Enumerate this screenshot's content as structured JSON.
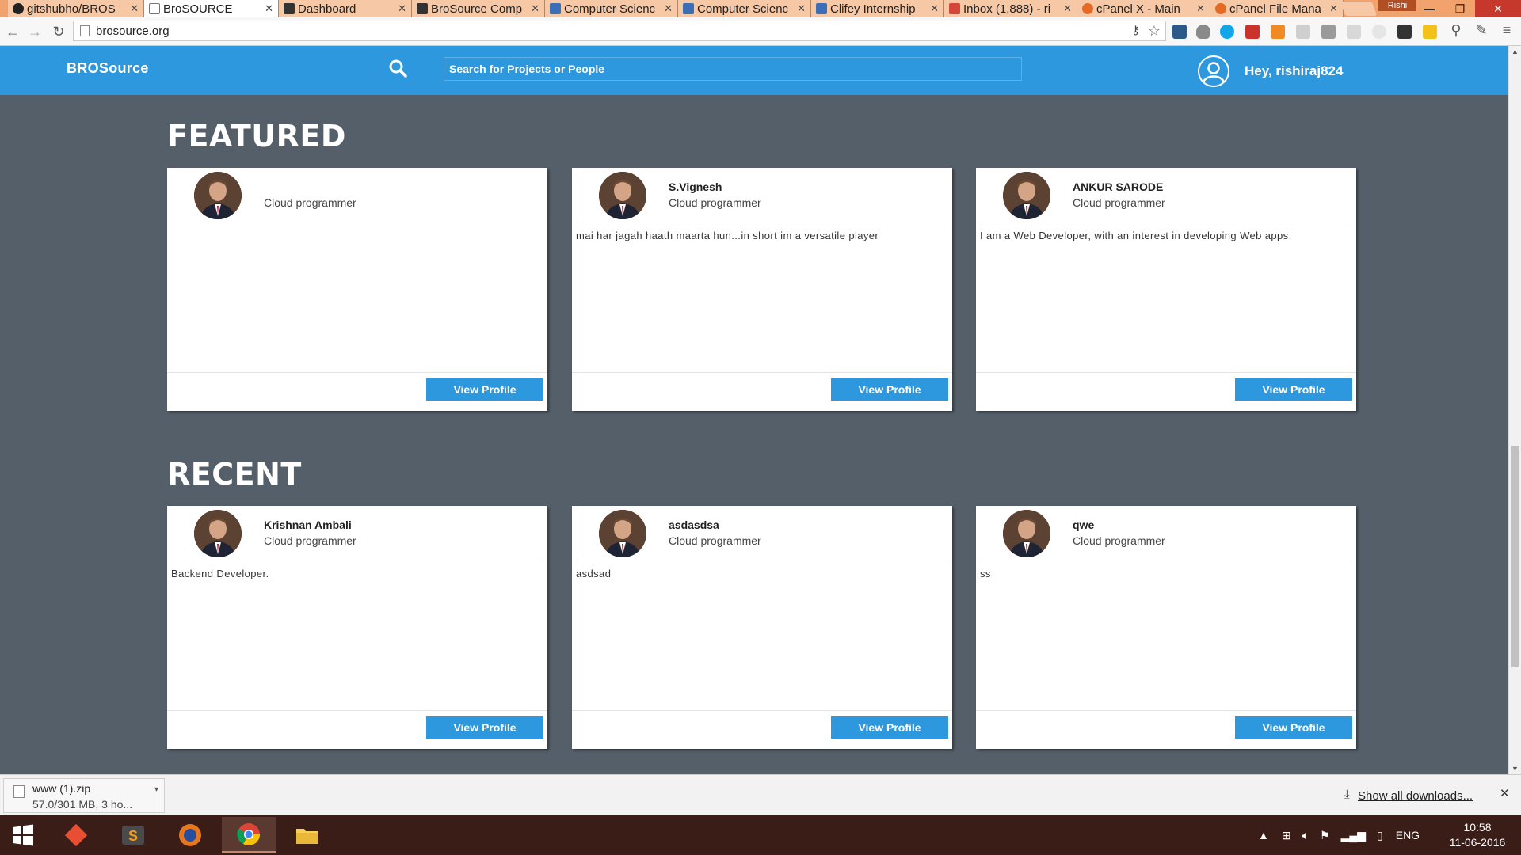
{
  "browser": {
    "tabs": [
      {
        "label": "gitshubho/BROS",
        "icon_color": "#222222",
        "active": false
      },
      {
        "label": "BroSOURCE",
        "icon_color": "#ffffff",
        "active": true
      },
      {
        "label": "Dashboard",
        "icon_color": "#333333",
        "active": false
      },
      {
        "label": "BroSource Comp",
        "icon_color": "#333333",
        "active": false
      },
      {
        "label": "Computer Scienc",
        "icon_color": "#3a6fb5",
        "active": false
      },
      {
        "label": "Computer Scienc",
        "icon_color": "#3a6fb5",
        "active": false
      },
      {
        "label": "Clifey Internship",
        "icon_color": "#3a6fb5",
        "active": false
      },
      {
        "label": "Inbox (1,888) - ri",
        "icon_color": "#d44638",
        "active": false
      },
      {
        "label": "cPanel X - Main",
        "icon_color": "#e66a25",
        "active": false
      },
      {
        "label": "cPanel File Mana",
        "icon_color": "#e66a25",
        "active": false
      }
    ],
    "profile_name": "Rishi",
    "url": "brosource.org"
  },
  "header": {
    "brand": "BROSource",
    "search_placeholder": "Search for Projects or People",
    "greeting": "Hey, rishiraj824"
  },
  "featured": {
    "title": "FEATURED",
    "cards": [
      {
        "name": "",
        "role": "Cloud programmer",
        "bio": "",
        "button": "View Profile"
      },
      {
        "name": "S.Vignesh",
        "role": "Cloud programmer",
        "bio": "mai har jagah haath maarta hun...in short im a versatile player",
        "button": "View Profile"
      },
      {
        "name": "ANKUR SARODE",
        "role": "Cloud programmer",
        "bio": "I am a Web Developer, with an interest in developing Web apps.",
        "button": "View Profile"
      }
    ]
  },
  "recent": {
    "title": "RECENT",
    "cards": [
      {
        "name": "Krishnan Ambali",
        "role": "Cloud programmer",
        "bio": "Backend Developer.",
        "button": "View Profile"
      },
      {
        "name": "asdasdsa",
        "role": "Cloud programmer",
        "bio": "asdsad",
        "button": "View Profile"
      },
      {
        "name": "qwe",
        "role": "Cloud programmer",
        "bio": "ss",
        "button": "View Profile"
      }
    ]
  },
  "downloads": {
    "file_name": "www (1).zip",
    "status": "57.0/301 MB, 3 ho...",
    "show_all": "Show all downloads..."
  },
  "taskbar": {
    "language": "ENG",
    "time": "10:58",
    "date": "11-06-2016"
  },
  "colors": {
    "accent": "#2e98de",
    "page_bg": "#545f69",
    "card_bg": "#ffffff"
  }
}
